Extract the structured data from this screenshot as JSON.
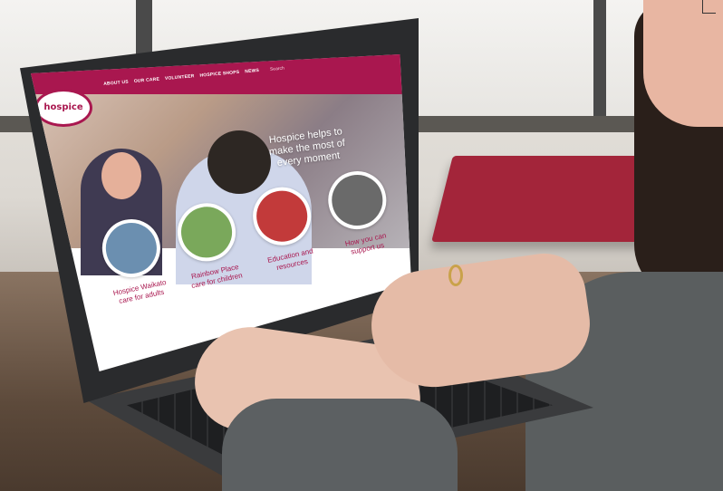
{
  "photo": {
    "subject": "",
    "laptop_site": {
      "logo_text": "hospice",
      "nav": [
        "ABOUT US",
        "OUR CARE",
        "VOLUNTEER",
        "HOSPICE SHOPS",
        "NEWS"
      ],
      "search_placeholder": "Search",
      "tagline": "Hospice helps to make the most of every moment",
      "cards": [
        {
          "label": "Hospice Waikato care for adults",
          "color": "#6b8fb0"
        },
        {
          "label": "Rainbow Place care for children",
          "color": "#7aa85b"
        },
        {
          "label": "Education and resources",
          "color": "#c23a3a"
        },
        {
          "label": "How you can support us",
          "color": "#6a6a6a"
        }
      ],
      "brand_color": "#a9174f"
    }
  }
}
